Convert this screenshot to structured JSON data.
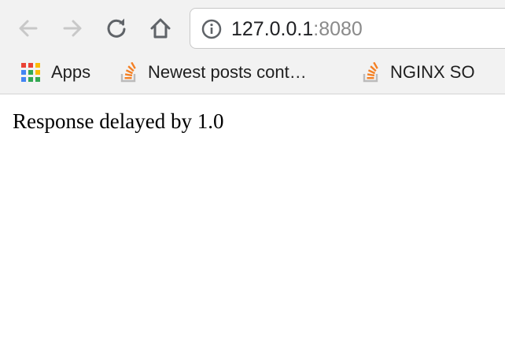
{
  "browser": {
    "address_bar": {
      "host": "127.0.0.1",
      "port": ":8080"
    },
    "bookmarks": [
      {
        "label": "Apps",
        "icon": "apps-grid-icon"
      },
      {
        "label": "Newest posts cont…",
        "icon": "stackoverflow-icon"
      },
      {
        "label": "NGINX SO",
        "icon": "stackoverflow-icon"
      }
    ]
  },
  "page": {
    "body_text": "Response delayed by 1.0"
  },
  "colors": {
    "toolbar_bg": "#f2f2f2",
    "stackoverflow_orange": "#f48024",
    "url_port_gray": "#8a8a8a"
  }
}
